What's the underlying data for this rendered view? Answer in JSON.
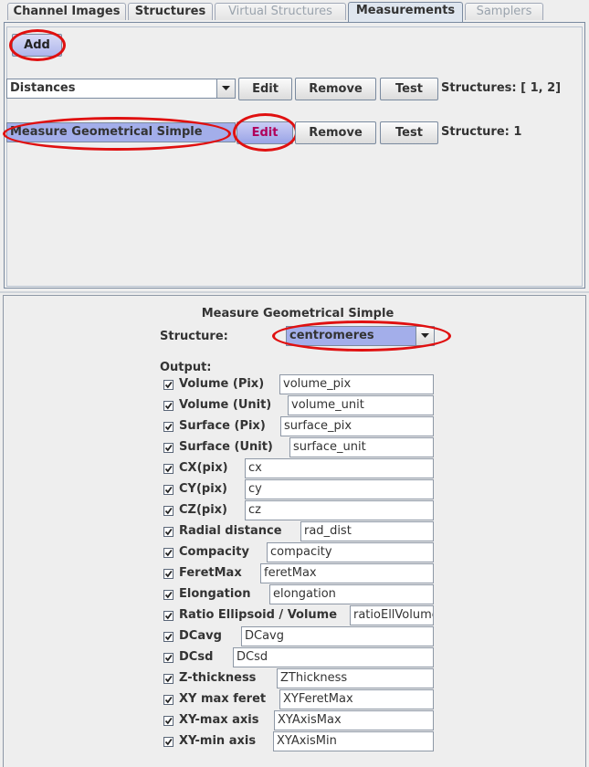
{
  "tabs": [
    {
      "label": "Channel Images",
      "state": "normal"
    },
    {
      "label": "Structures",
      "state": "normal"
    },
    {
      "label": "Virtual Structures",
      "state": "disabled"
    },
    {
      "label": "Measurements",
      "state": "active"
    },
    {
      "label": "Samplers",
      "state": "disabled"
    }
  ],
  "top": {
    "add_label": "Add",
    "rows": [
      {
        "combo_value": "Distances",
        "edit": "Edit",
        "remove": "Remove",
        "test": "Test",
        "structures": "Structures: [ 1, 2]"
      },
      {
        "combo_value": "Measure Geometrical Simple",
        "edit": "Edit",
        "remove": "Remove",
        "test": "Test",
        "structures": "Structure: 1"
      }
    ]
  },
  "detail": {
    "title": "Measure Geometrical Simple",
    "structure_label": "Structure:",
    "structure_value": "centromeres",
    "output_label": "Output:",
    "outputs": [
      {
        "label": "Volume (Pix)",
        "value": "volume_pix",
        "checked": true
      },
      {
        "label": "Volume (Unit)",
        "value": "volume_unit",
        "checked": true
      },
      {
        "label": "Surface (Pix)",
        "value": "surface_pix",
        "checked": true
      },
      {
        "label": "Surface (Unit)",
        "value": "surface_unit",
        "checked": true
      },
      {
        "label": "CX(pix)",
        "value": "cx",
        "checked": true
      },
      {
        "label": "CY(pix)",
        "value": "cy",
        "checked": true
      },
      {
        "label": "CZ(pix)",
        "value": "cz",
        "checked": true
      },
      {
        "label": "Radial distance",
        "value": "rad_dist",
        "checked": true
      },
      {
        "label": "Compacity",
        "value": "compacity",
        "checked": true
      },
      {
        "label": "FeretMax",
        "value": "feretMax",
        "checked": true
      },
      {
        "label": "Elongation",
        "value": "elongation",
        "checked": true
      },
      {
        "label": "Ratio Ellipsoid / Volume",
        "value": "ratioEllVolume",
        "checked": true
      },
      {
        "label": "DCavg",
        "value": "DCavg",
        "checked": true
      },
      {
        "label": "DCsd",
        "value": "DCsd",
        "checked": true
      },
      {
        "label": "Z-thickness",
        "value": "ZThickness",
        "checked": true
      },
      {
        "label": "XY max feret",
        "value": "XYFeretMax",
        "checked": true
      },
      {
        "label": "XY-max axis",
        "value": "XYAxisMax",
        "checked": true
      },
      {
        "label": "XY-min axis",
        "value": "XYAxisMin",
        "checked": true
      }
    ]
  },
  "colors": {
    "highlight_ring": "#e01010",
    "selection": "#a3aeea"
  }
}
